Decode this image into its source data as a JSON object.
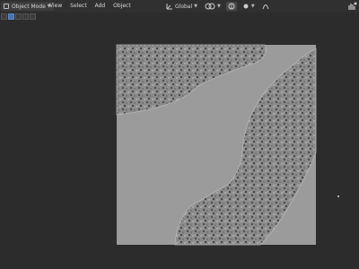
{
  "header": {
    "mode": "Object Mode",
    "menus": [
      "View",
      "Select",
      "Add",
      "Object"
    ],
    "transform_orientation": "Global"
  },
  "icons": {
    "mode": "cube-icon",
    "orientation": "axes-icon",
    "snap": "magnet-icon",
    "pivot": "pivot-icon",
    "proportional": "circle-dot-icon",
    "falloff": "falloff-curve-icon",
    "view_gizmo": "hand-icon"
  },
  "colors": {
    "background": "#2c2c2c",
    "plane": "#9b9b9b",
    "stones_region": "#8c8c8c",
    "header": "#303030"
  }
}
